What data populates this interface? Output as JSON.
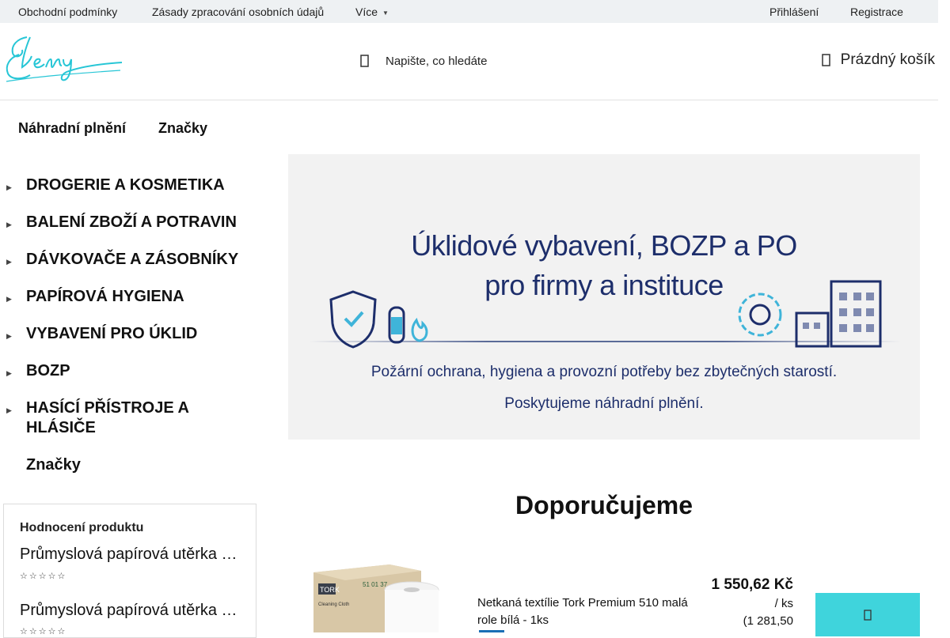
{
  "topbar": {
    "links": [
      "Obchodní podmínky",
      "Zásady zpracování osobních údajů",
      "Více"
    ],
    "login": "Přihlášení",
    "register": "Registrace"
  },
  "header": {
    "logo_text": "Eleny",
    "search_placeholder": "Napište, co hledáte",
    "search_icon": "search-icon",
    "cart_label": "Prázdný košík",
    "cart_icon": "cart-icon"
  },
  "mainnav": [
    "Náhradní plnění",
    "Značky"
  ],
  "categories": [
    "DROGERIE A KOSMETIKA",
    "BALENÍ ZBOŽÍ A POTRAVIN",
    "DÁVKOVAČE A ZÁSOBNÍKY",
    "PAPÍROVÁ HYGIENA",
    "VYBAVENÍ PRO ÚKLID",
    "BOZP",
    "HASÍCÍ PŘÍSTROJE A HLÁSIČE",
    "Značky"
  ],
  "banner": {
    "line1": "Úklidové vybavení, BOZP a PO",
    "line2": "pro firmy a instituce",
    "line3": "Požární ochrana, hygiena a provozní potřeby bez zbytečných starostí.",
    "line4": "Poskytujeme náhradní plnění."
  },
  "recommend": {
    "heading": "Doporučujeme"
  },
  "reviews": {
    "heading": "Hodnocení produktu",
    "items": [
      {
        "name": "Průmyslová papírová utěrka …",
        "rating": 0
      },
      {
        "name": "Průmyslová papírová utěrka …",
        "rating": 0
      }
    ]
  },
  "product": {
    "name": "Netkaná textílie Tork Premium 510 malá role bílá - 1ks",
    "price": "1 550,62 Kč",
    "unit": "/ ks",
    "price_no_vat": "(1 281,50",
    "box_brand": "TORK",
    "box_code": "51 01 37",
    "box_product": "Cleaning Cloth"
  },
  "colors": {
    "topbar_bg": "#eef1f3",
    "accent": "#3fd4dc",
    "logo": "#27c6d6",
    "banner_text": "#1d2e6b"
  }
}
